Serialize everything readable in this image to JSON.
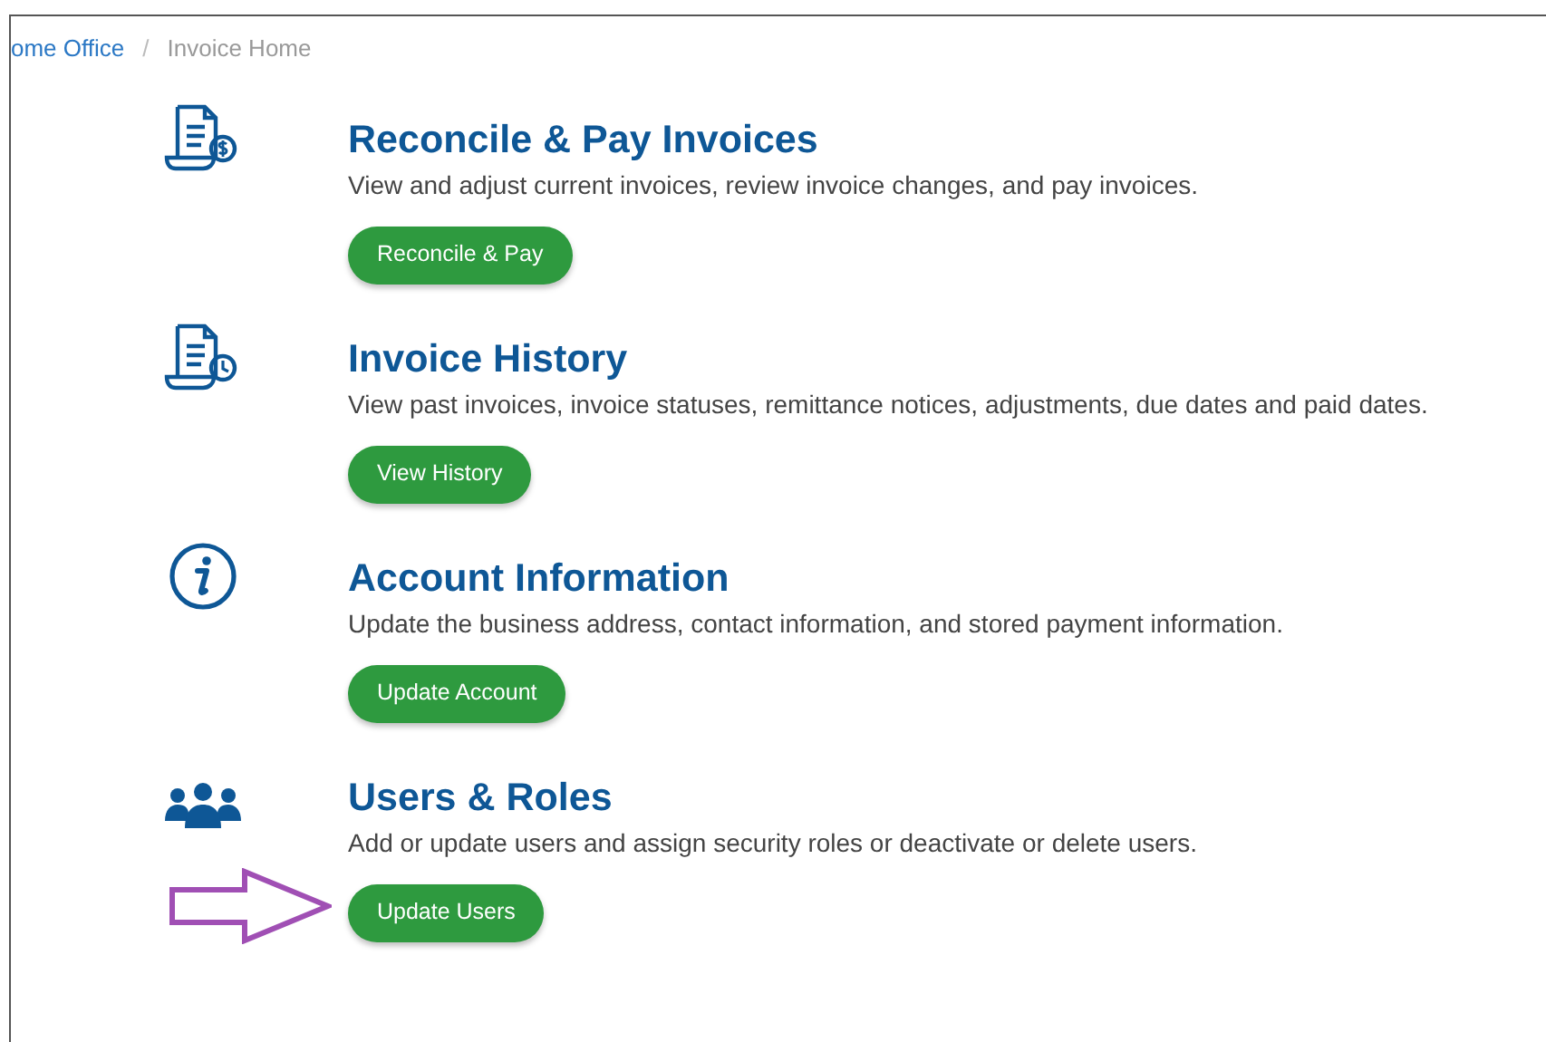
{
  "breadcrumb": [
    {
      "label": "ome Office",
      "kind": "link"
    },
    {
      "label": "Invoice Home",
      "kind": "current",
      "separator": "/"
    }
  ],
  "sections": [
    {
      "kind": "invoice-dollar",
      "title": "Reconcile & Pay Invoices",
      "description": "View and adjust current invoices, review invoice changes, and pay invoices.",
      "button": "Reconcile & Pay",
      "highlighted": false
    },
    {
      "kind": "invoice-clock",
      "title": "Invoice History",
      "description": "View past invoices, invoice statuses, remittance notices, adjustments, due dates and paid dates.",
      "button": "View History",
      "highlighted": false
    },
    {
      "kind": "info",
      "title": "Account Information",
      "description": "Update the business address, contact information, and stored payment information.",
      "button": "Update Account",
      "highlighted": false
    },
    {
      "kind": "users",
      "title": "Users & Roles",
      "description": "Add or update users and assign security roles or deactivate or delete users.",
      "button": "Update Users",
      "highlighted": true
    }
  ]
}
